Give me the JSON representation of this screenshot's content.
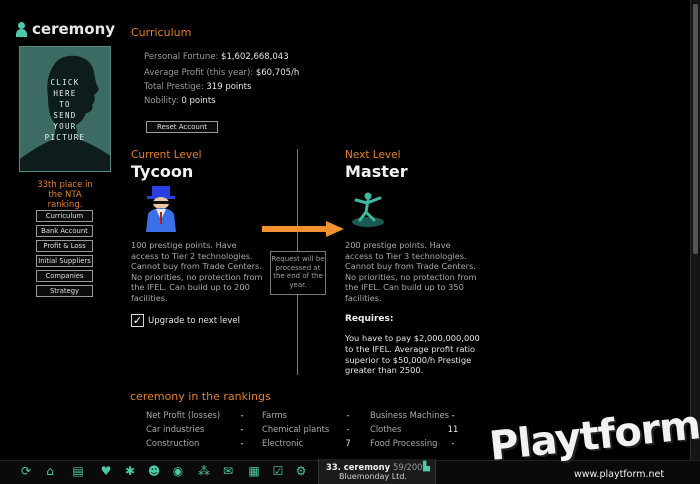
{
  "sidebar": {
    "username": "ceremony",
    "photo_text": "CLICK\nHERE\nTO\nSEND\nYOUR\nPICTURE",
    "ranking": "33th place in\nthe NTA\nranking.",
    "buttons": [
      "Curriculum",
      "Bank Account",
      "Profit & Loss",
      "Initial Suppliers",
      "Companies",
      "Strategy"
    ]
  },
  "curriculum": {
    "title": "Curriculum",
    "fortune_label": "Personal Fortune:",
    "fortune_value": "$1,602,668,043",
    "profit_label": "Average Profit (this year):",
    "profit_value": "$60,705/h",
    "prestige_label": "Total Prestige:",
    "prestige_value": "319 points",
    "nobility_label": "Nobility:",
    "nobility_value": "0 points",
    "reset_button": "Reset Account"
  },
  "current_level": {
    "label": "Current Level",
    "name": "Tycoon",
    "description": "100 prestige points. Have access to Tier 2 technologies. Cannot buy from Trade Centers. No priorities, no protection from the IFEL. Can build up to 200 facilities."
  },
  "next_level": {
    "label": "Next Level",
    "name": "Master",
    "description": "200 prestige points. Have access to Tier 3 technologies. Cannot buy from Trade Centers. No priorities, no protection from the IFEL. Can build up to 350 facilities.",
    "requires_label": "Requires:",
    "requires_text": "You have to pay $2,000,000,000 to the IFEL. Average profit ratio superior to $50,000/h Prestige greater than 2500."
  },
  "request_note": "Request will be processed at the end of the year.",
  "upgrade": {
    "label": "Upgrade to next level",
    "checked": true,
    "check_mark": "✓"
  },
  "rankings": {
    "title": "ceremony in the rankings",
    "col1": [
      {
        "label": "Net Profit (losses)",
        "value": "-"
      },
      {
        "label": "Car industries",
        "value": "-"
      },
      {
        "label": "Construction",
        "value": "-"
      }
    ],
    "col2": [
      {
        "label": "Farms",
        "value": "-"
      },
      {
        "label": "Chemical plants",
        "value": "-"
      },
      {
        "label": "Electronic",
        "value": "7"
      }
    ],
    "col3": [
      {
        "label": "Business Machines",
        "value": "-"
      },
      {
        "label": "Clothes",
        "value": "11"
      },
      {
        "label": "Food Processing",
        "value": "-"
      }
    ]
  },
  "toolbar": {
    "icons": [
      "refresh-icon",
      "home-icon",
      "newspaper-icon",
      "heart-icon",
      "bug-icon",
      "user-icon",
      "eye-icon",
      "molecule-icon",
      "mail-icon",
      "building-icon",
      "checkbox-icon",
      "gear-icon"
    ],
    "company_rank": "33. ceremony",
    "company_count": "59/200",
    "company_name": "Bluemonday Ltd."
  },
  "watermark": {
    "brand": "Playtform",
    "url": "www.playtform.net"
  },
  "colors": {
    "accent_orange": "#e0812f",
    "accent_teal": "#4ec9a8",
    "background": "#000000"
  }
}
